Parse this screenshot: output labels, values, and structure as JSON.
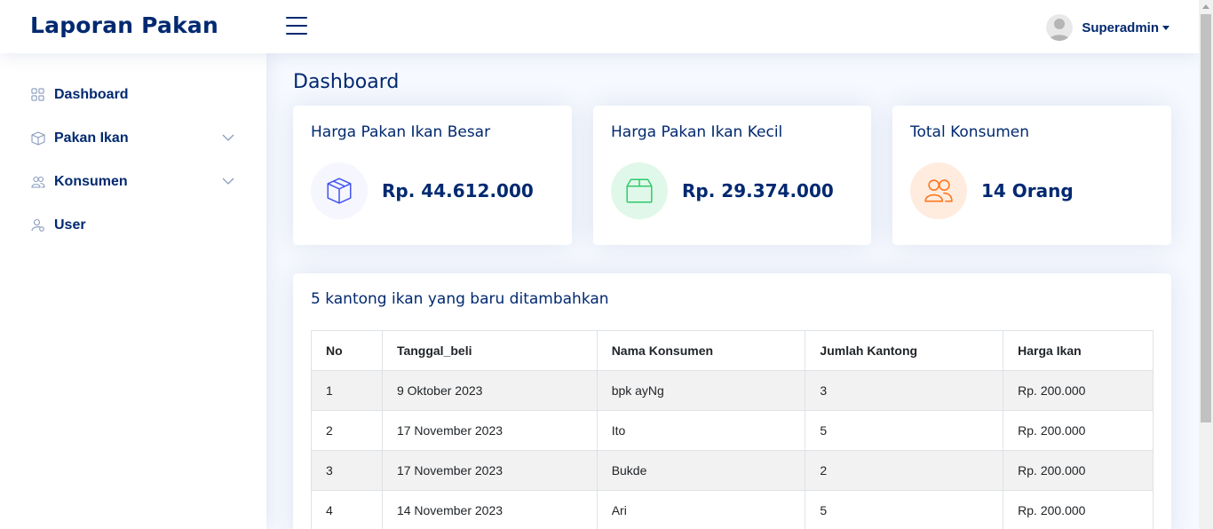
{
  "header": {
    "brand": "Laporan Pakan",
    "user_name": "Superadmin"
  },
  "sidebar": {
    "items": [
      {
        "label": "Dashboard",
        "icon": "grid-icon",
        "has_submenu": false
      },
      {
        "label": "Pakan Ikan",
        "icon": "box-icon",
        "has_submenu": true
      },
      {
        "label": "Konsumen",
        "icon": "people-icon",
        "has_submenu": true
      },
      {
        "label": "User",
        "icon": "person-gear-icon",
        "has_submenu": false
      }
    ]
  },
  "main": {
    "page_title": "Dashboard",
    "cards": [
      {
        "title": "Harga Pakan Ikan Besar",
        "value": "Rp. 44.612.000",
        "icon": "box-icon",
        "icon_color": "#4154f1",
        "icon_bg": "#f6f6fe"
      },
      {
        "title": "Harga Pakan Ikan Kecil",
        "value": "Rp. 29.374.000",
        "icon": "box-open-icon",
        "icon_color": "#2eca6a",
        "icon_bg": "#e0f8e9"
      },
      {
        "title": "Total Konsumen",
        "value": "14 Orang",
        "icon": "people-icon",
        "icon_color": "#ff771d",
        "icon_bg": "#ffecdf"
      }
    ],
    "table": {
      "title": "5 kantong ikan yang baru ditambahkan",
      "columns": [
        "No",
        "Tanggal_beli",
        "Nama Konsumen",
        "Jumlah Kantong",
        "Harga Ikan"
      ],
      "rows": [
        [
          "1",
          "9 Oktober 2023",
          "bpk ayNg",
          "3",
          "Rp. 200.000"
        ],
        [
          "2",
          "17 November 2023",
          "Ito",
          "5",
          "Rp. 200.000"
        ],
        [
          "3",
          "17 November 2023",
          "Bukde",
          "2",
          "Rp. 200.000"
        ],
        [
          "4",
          "14 November 2023",
          "Ari",
          "5",
          "Rp. 200.000"
        ]
      ]
    }
  }
}
